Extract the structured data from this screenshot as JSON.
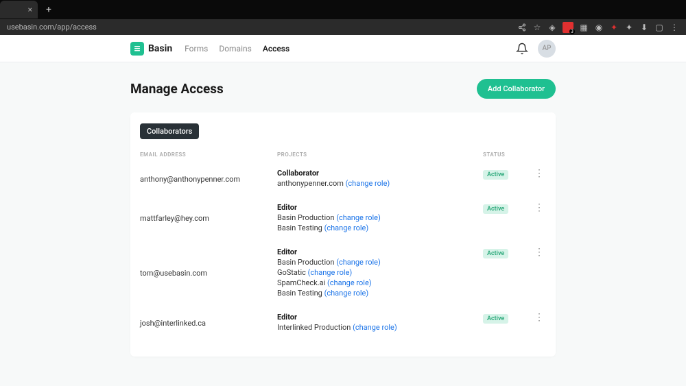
{
  "browser": {
    "url_prefix": "usebasin.com",
    "url_path": "/app/access"
  },
  "nav": {
    "brand": "Basin",
    "links": [
      {
        "label": "Forms",
        "active": false
      },
      {
        "label": "Domains",
        "active": false
      },
      {
        "label": "Access",
        "active": true
      }
    ],
    "avatar_initials": "AP"
  },
  "page": {
    "title": "Manage Access",
    "add_button": "Add Collaborator",
    "tab_label": "Collaborators",
    "columns": {
      "email": "EMAIL ADDRESS",
      "projects": "PROJECTS",
      "status": "STATUS"
    },
    "change_role_text": "(change role)",
    "rows": [
      {
        "email": "anthony@anthonypenner.com",
        "role": "Collaborator",
        "projects": [
          "anthonypenner.com"
        ],
        "status": "Active"
      },
      {
        "email": "mattfarley@hey.com",
        "role": "Editor",
        "projects": [
          "Basin Production",
          "Basin Testing"
        ],
        "status": "Active"
      },
      {
        "email": "tom@usebasin.com",
        "role": "Editor",
        "projects": [
          "Basin Production",
          "GoStatic",
          "SpamCheck.ai",
          "Basin Testing"
        ],
        "status": "Active"
      },
      {
        "email": "josh@interlinked.ca",
        "role": "Editor",
        "projects": [
          "Interlinked Production"
        ],
        "status": "Active"
      }
    ]
  }
}
